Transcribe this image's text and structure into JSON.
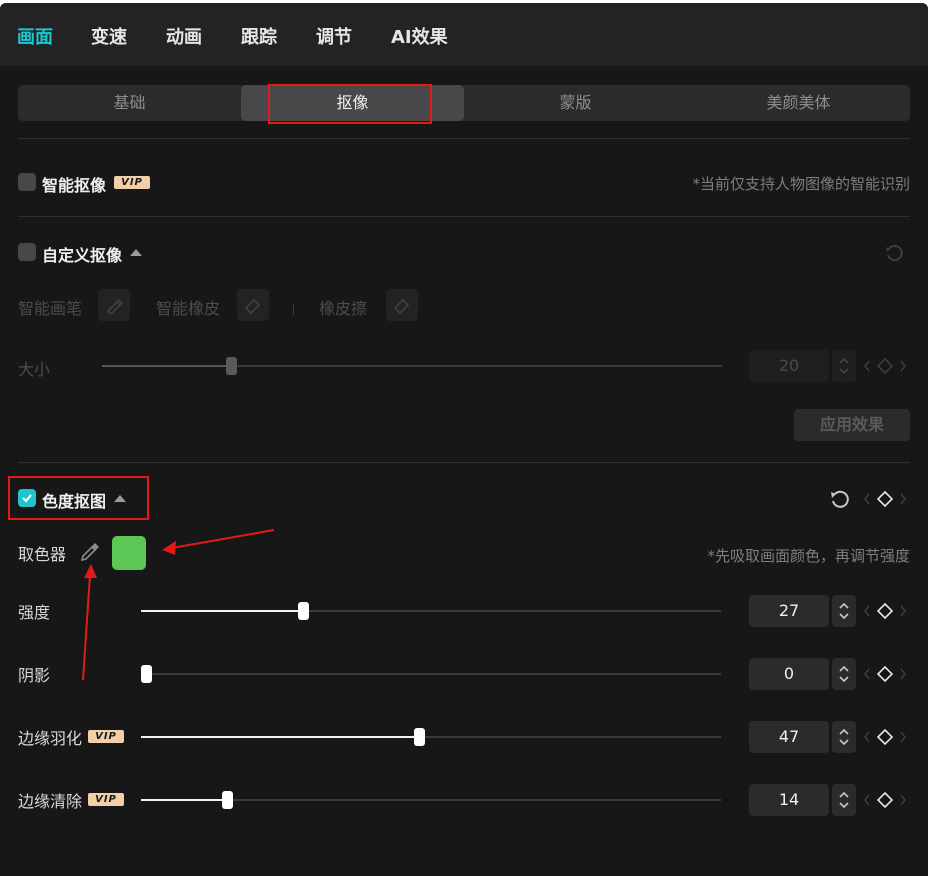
{
  "top_tabs": [
    "画面",
    "变速",
    "动画",
    "跟踪",
    "调节",
    "AI效果"
  ],
  "sub_tabs": [
    "基础",
    "抠像",
    "蒙版",
    "美颜美体"
  ],
  "smart_cutout": {
    "title": "智能抠像",
    "vip_badge": "VIP",
    "hint": "*当前仅支持人物图像的智能识别",
    "checked": false
  },
  "custom_cutout": {
    "title": "自定义抠像",
    "checked": false,
    "tools": [
      "智能画笔",
      "智能橡皮",
      "橡皮擦"
    ],
    "size_label": "大小",
    "size_value": "20",
    "size_fraction": 0.2,
    "apply_label": "应用效果"
  },
  "chroma_key": {
    "title": "色度抠图",
    "checked": true,
    "picker_label": "取色器",
    "picked_color": "#5cc755",
    "hint": "*先吸取画面颜色，再调节强度",
    "sliders": [
      {
        "label": "强度",
        "value": "27",
        "fraction": 0.27,
        "vip": false
      },
      {
        "label": "阴影",
        "value": "0",
        "fraction": 0.0,
        "vip": false
      },
      {
        "label": "边缘羽化",
        "value": "47",
        "fraction": 0.47,
        "vip": true
      },
      {
        "label": "边缘清除",
        "value": "14",
        "fraction": 0.14,
        "vip": true
      }
    ]
  },
  "colors": {
    "accent": "#1cc7d0",
    "highlight_red": "#e31a1a"
  }
}
